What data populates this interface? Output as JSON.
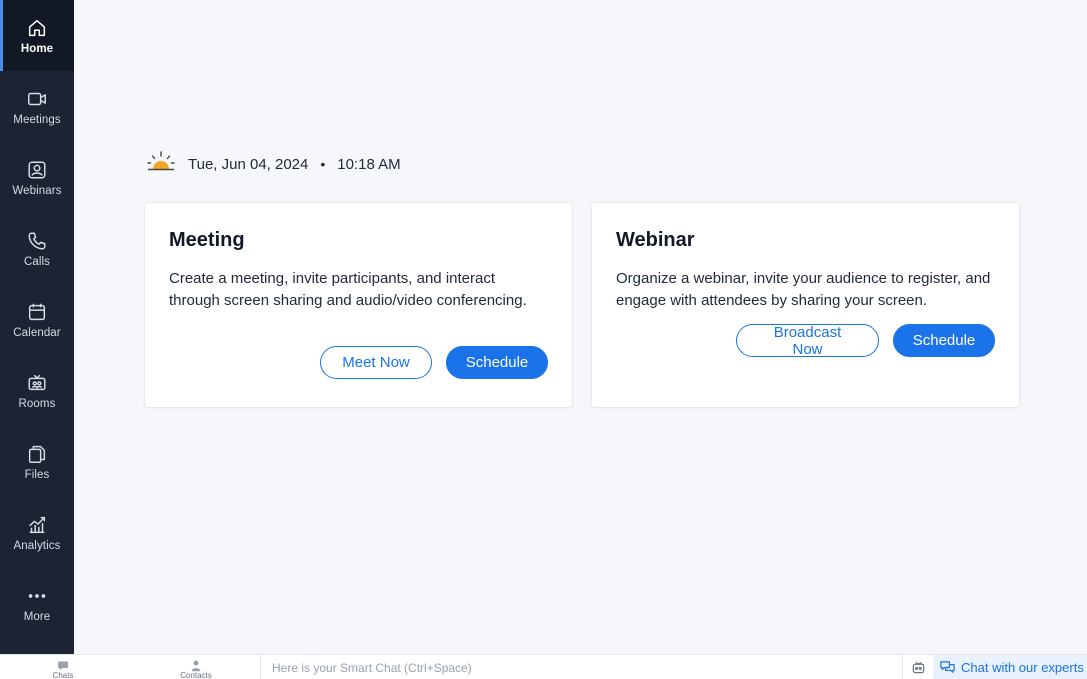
{
  "sidebar": {
    "items": [
      {
        "label": "Home",
        "icon": "home-icon",
        "active": true
      },
      {
        "label": "Meetings",
        "icon": "video-camera-icon"
      },
      {
        "label": "Webinars",
        "icon": "webinar-icon"
      },
      {
        "label": "Calls",
        "icon": "phone-icon"
      },
      {
        "label": "Calendar",
        "icon": "calendar-icon"
      },
      {
        "label": "Rooms",
        "icon": "rooms-icon"
      },
      {
        "label": "Files",
        "icon": "files-icon"
      },
      {
        "label": "Analytics",
        "icon": "analytics-icon"
      },
      {
        "label": "More",
        "icon": "more-icon"
      }
    ]
  },
  "header": {
    "date": "Tue, Jun 04, 2024",
    "separator": "•",
    "time": "10:18 AM"
  },
  "meeting_card": {
    "title": "Meeting",
    "description": "Create a meeting, invite participants, and interact through screen sharing and audio/video conferencing.",
    "secondary_button": "Meet Now",
    "primary_button": "Schedule"
  },
  "webinar_card": {
    "title": "Webinar",
    "description": "Organize a webinar, invite your audience to register, and engage with attendees by sharing your screen.",
    "secondary_button": "Broadcast Now",
    "primary_button": "Schedule"
  },
  "bottombar": {
    "chats_label": "Chats",
    "contacts_label": "Contacts",
    "smartchat_placeholder": "Here is your Smart Chat (Ctrl+Space)",
    "chat_experts_label": "Chat with our experts"
  },
  "colors": {
    "sidebar_bg": "#1c2433",
    "sidebar_active_bg": "#121925",
    "accent": "#1a73e8",
    "main_bg": "#f5f7fb",
    "sun": "#f5a623"
  }
}
